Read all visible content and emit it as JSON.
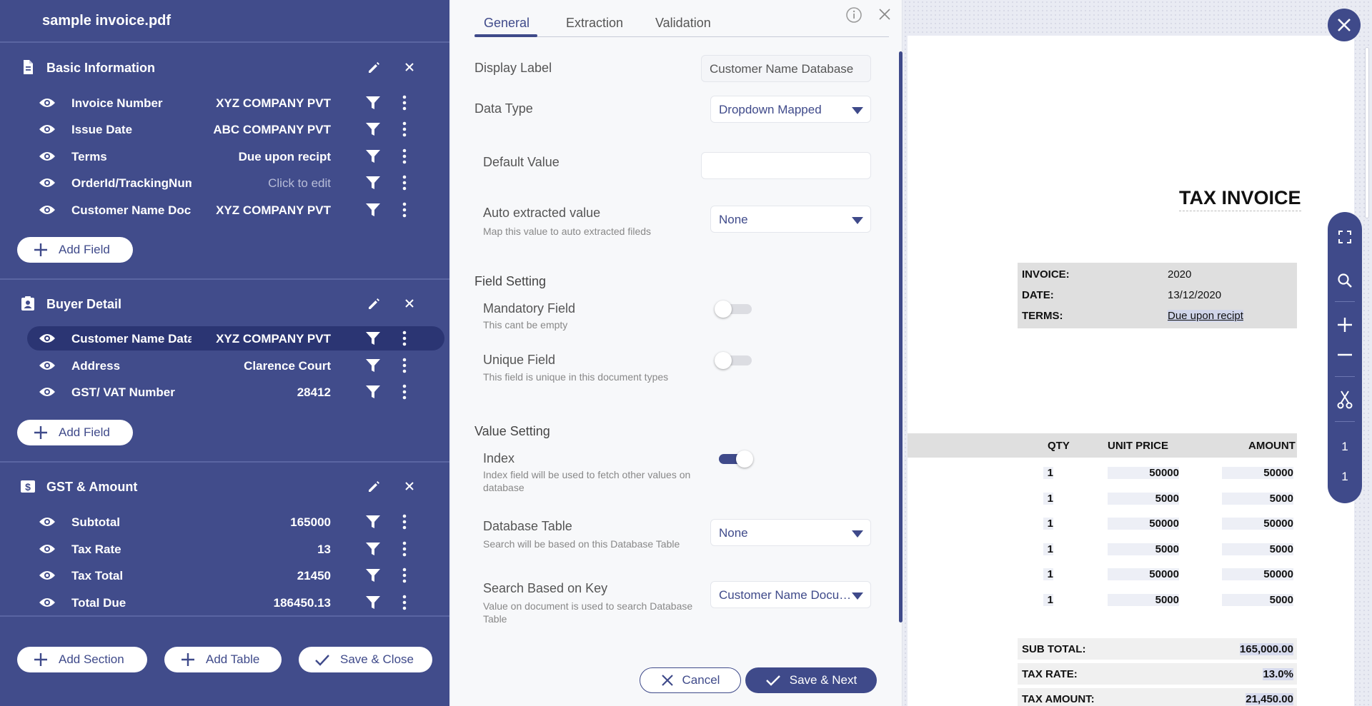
{
  "sidebar": {
    "file_title": "sample invoice.pdf",
    "sections": [
      {
        "title": "Basic Information",
        "icon": "document-icon",
        "fields": [
          {
            "name": "Invoice Number",
            "value": "XYZ COMPANY PVT"
          },
          {
            "name": "Issue Date",
            "value": "ABC COMPANY PVT"
          },
          {
            "name": "Terms",
            "value": "Due upon recipt"
          },
          {
            "name": "OrderId/TrackingNumber",
            "value": "Click to edit"
          },
          {
            "name": "Customer Name Document",
            "value": "XYZ COMPANY PVT"
          }
        ]
      },
      {
        "title": "Buyer Detail",
        "icon": "contact-card-icon",
        "fields": [
          {
            "name": "Customer Name Database",
            "value": "XYZ COMPANY PVT"
          },
          {
            "name": "Address",
            "value": "Clarence Court"
          },
          {
            "name": "GST/ VAT Number",
            "value": "28412"
          }
        ]
      },
      {
        "title": "GST & Amount",
        "icon": "dollar-icon",
        "fields": [
          {
            "name": "Subtotal",
            "value": "165000"
          },
          {
            "name": "Tax Rate",
            "value": "13"
          },
          {
            "name": "Tax Total",
            "value": "21450"
          },
          {
            "name": "Total Due",
            "value": "186450.13"
          }
        ]
      }
    ],
    "add_field_label": "Add Field",
    "add_section_label": "Add Section",
    "add_table_label": "Add Table",
    "save_close_label": "Save & Close"
  },
  "config": {
    "tabs": [
      "General",
      "Extraction",
      "Validation"
    ],
    "display_label": {
      "label": "Display Label",
      "value": "Customer Name Database"
    },
    "data_type": {
      "label": "Data Type",
      "value": "Dropdown Mapped"
    },
    "default_value": {
      "label": "Default Value",
      "value": ""
    },
    "auto_extracted": {
      "label": "Auto extracted value",
      "hint": "Map this value to auto extracted fileds",
      "value": "None"
    },
    "field_setting": {
      "heading": "Field Setting",
      "mandatory": {
        "label": "Mandatory Field",
        "hint": "This cant be empty",
        "on": false
      },
      "unique": {
        "label": "Unique Field",
        "hint": "This field is unique in this document types",
        "on": false
      }
    },
    "value_setting": {
      "heading": "Value Setting",
      "index": {
        "label": "Index",
        "hint": "Index field will be used to fetch other values on database",
        "on": true
      },
      "database_table": {
        "label": "Database Table",
        "hint": "Search will be based on this Database Table",
        "value": "None"
      },
      "search_key": {
        "label": "Search Based on Key",
        "hint": "Value on document is used to search Database Table",
        "value": "Customer Name Document"
      }
    },
    "cancel_label": "Cancel",
    "save_next_label": "Save & Next"
  },
  "document": {
    "title": "TAX INVOICE",
    "meta": [
      {
        "key": "INVOICE:",
        "value": "2020"
      },
      {
        "key": "DATE:",
        "value": "13/12/2020"
      },
      {
        "key": "TERMS:",
        "value": "Due upon recipt"
      }
    ],
    "table_headers": [
      "QTY",
      "UNIT PRICE",
      "AMOUNT"
    ],
    "table_rows": [
      [
        "1",
        "50000",
        "50000"
      ],
      [
        "1",
        "5000",
        "5000"
      ],
      [
        "1",
        "50000",
        "50000"
      ],
      [
        "1",
        "5000",
        "5000"
      ],
      [
        "1",
        "50000",
        "50000"
      ],
      [
        "1",
        "5000",
        "5000"
      ]
    ],
    "totals": [
      {
        "key": "SUB TOTAL:",
        "value": "165,000.00"
      },
      {
        "key": "TAX RATE:",
        "value": "13.0%"
      },
      {
        "key": "TAX AMOUNT:",
        "value": "21,450.00"
      }
    ]
  },
  "viewer_toolbar": {
    "tools": [
      "fullscreen-icon",
      "search-icon",
      "zoom-in-icon",
      "zoom-out-icon",
      "scissors-icon"
    ],
    "current_page": "1",
    "total_pages": "1"
  },
  "colors": {
    "primary": "#414c8b",
    "accent": "#3f4a8a",
    "selected_row": "#2b3573"
  }
}
